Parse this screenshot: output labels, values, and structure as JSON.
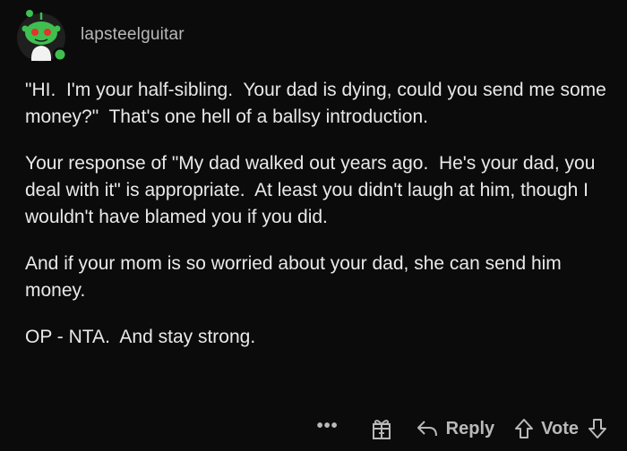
{
  "comment": {
    "author": "lapsteelguitar",
    "paragraphs": [
      "\"HI.  I'm your half-sibling.  Your dad is dying, could you send me some money?\"  That's one hell of a ballsy introduction.",
      "Your response of \"My dad walked out years ago.  He's your dad, you deal with it\" is appropriate.  At least you didn't laugh at him, though I wouldn't have blamed you if you did.",
      "And if your mom is so worried about your dad, she can send him money.",
      "OP - NTA.  And stay strong."
    ]
  },
  "actions": {
    "more_label": "•••",
    "reply_label": "Reply",
    "vote_label": "Vote"
  },
  "icons": {
    "avatar": "reddit-snoo-avatar",
    "more": "more-options-icon",
    "award": "gift-award-icon",
    "reply": "reply-arrow-icon",
    "upvote": "upvote-arrow-icon",
    "downvote": "downvote-arrow-icon"
  },
  "colors": {
    "background": "#0b0b0b",
    "avatar_green": "#3fbf4f",
    "avatar_red_eyes": "#e0342c",
    "text": "#e9e9e9",
    "muted": "#b9b9b9"
  }
}
